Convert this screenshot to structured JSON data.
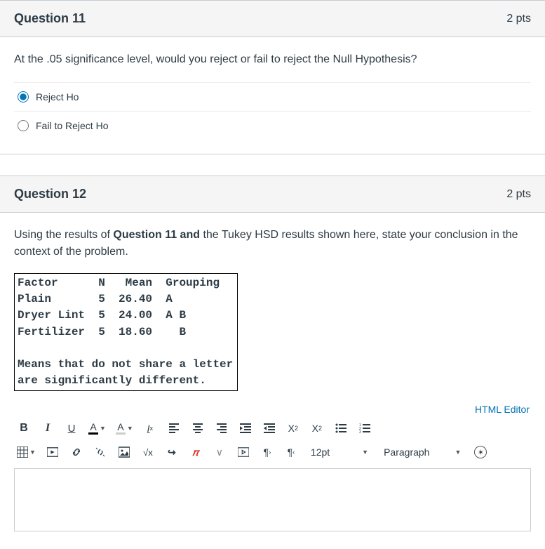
{
  "q11": {
    "title": "Question 11",
    "pts": "2 pts",
    "text": "At the .05 significance level, would you reject or fail to reject the Null Hypothesis?",
    "answers": [
      {
        "label": "Reject Ho",
        "selected": true
      },
      {
        "label": "Fail to Reject Ho",
        "selected": false
      }
    ]
  },
  "q12": {
    "title": "Question 12",
    "pts": "2 pts",
    "text_pre": "Using the results of ",
    "text_bold": "Question 11 and",
    "text_post": " the Tukey HSD results shown here, state your conclusion in the context of the problem.",
    "tukey": "Factor      N   Mean  Grouping\nPlain       5  26.40  A\nDryer Lint  5  24.00  A B\nFertilizer  5  18.60    B\n\nMeans that do not share a letter\nare significantly different."
  },
  "editor": {
    "html_link": "HTML Editor",
    "fontsize": "12pt",
    "paragraph": "Paragraph",
    "icons": {
      "bold": "B",
      "italic": "I",
      "underline": "U",
      "fontcolor": "A",
      "bgcolor": "A",
      "clear": "T",
      "sup_base": "X",
      "sub_base": "X",
      "a11y": "✦",
      "sqrt": "√x",
      "arrow": "↔",
      "pi": "π",
      "vee": "∨",
      "ltr": "¶",
      "rtl": "¶"
    }
  },
  "chart_data": {
    "type": "table",
    "title": "Tukey HSD Grouping",
    "columns": [
      "Factor",
      "N",
      "Mean",
      "Grouping"
    ],
    "rows": [
      {
        "Factor": "Plain",
        "N": 5,
        "Mean": 26.4,
        "Grouping": "A"
      },
      {
        "Factor": "Dryer Lint",
        "N": 5,
        "Mean": 24.0,
        "Grouping": "A B"
      },
      {
        "Factor": "Fertilizer",
        "N": 5,
        "Mean": 18.6,
        "Grouping": "B"
      }
    ],
    "note": "Means that do not share a letter are significantly different."
  }
}
